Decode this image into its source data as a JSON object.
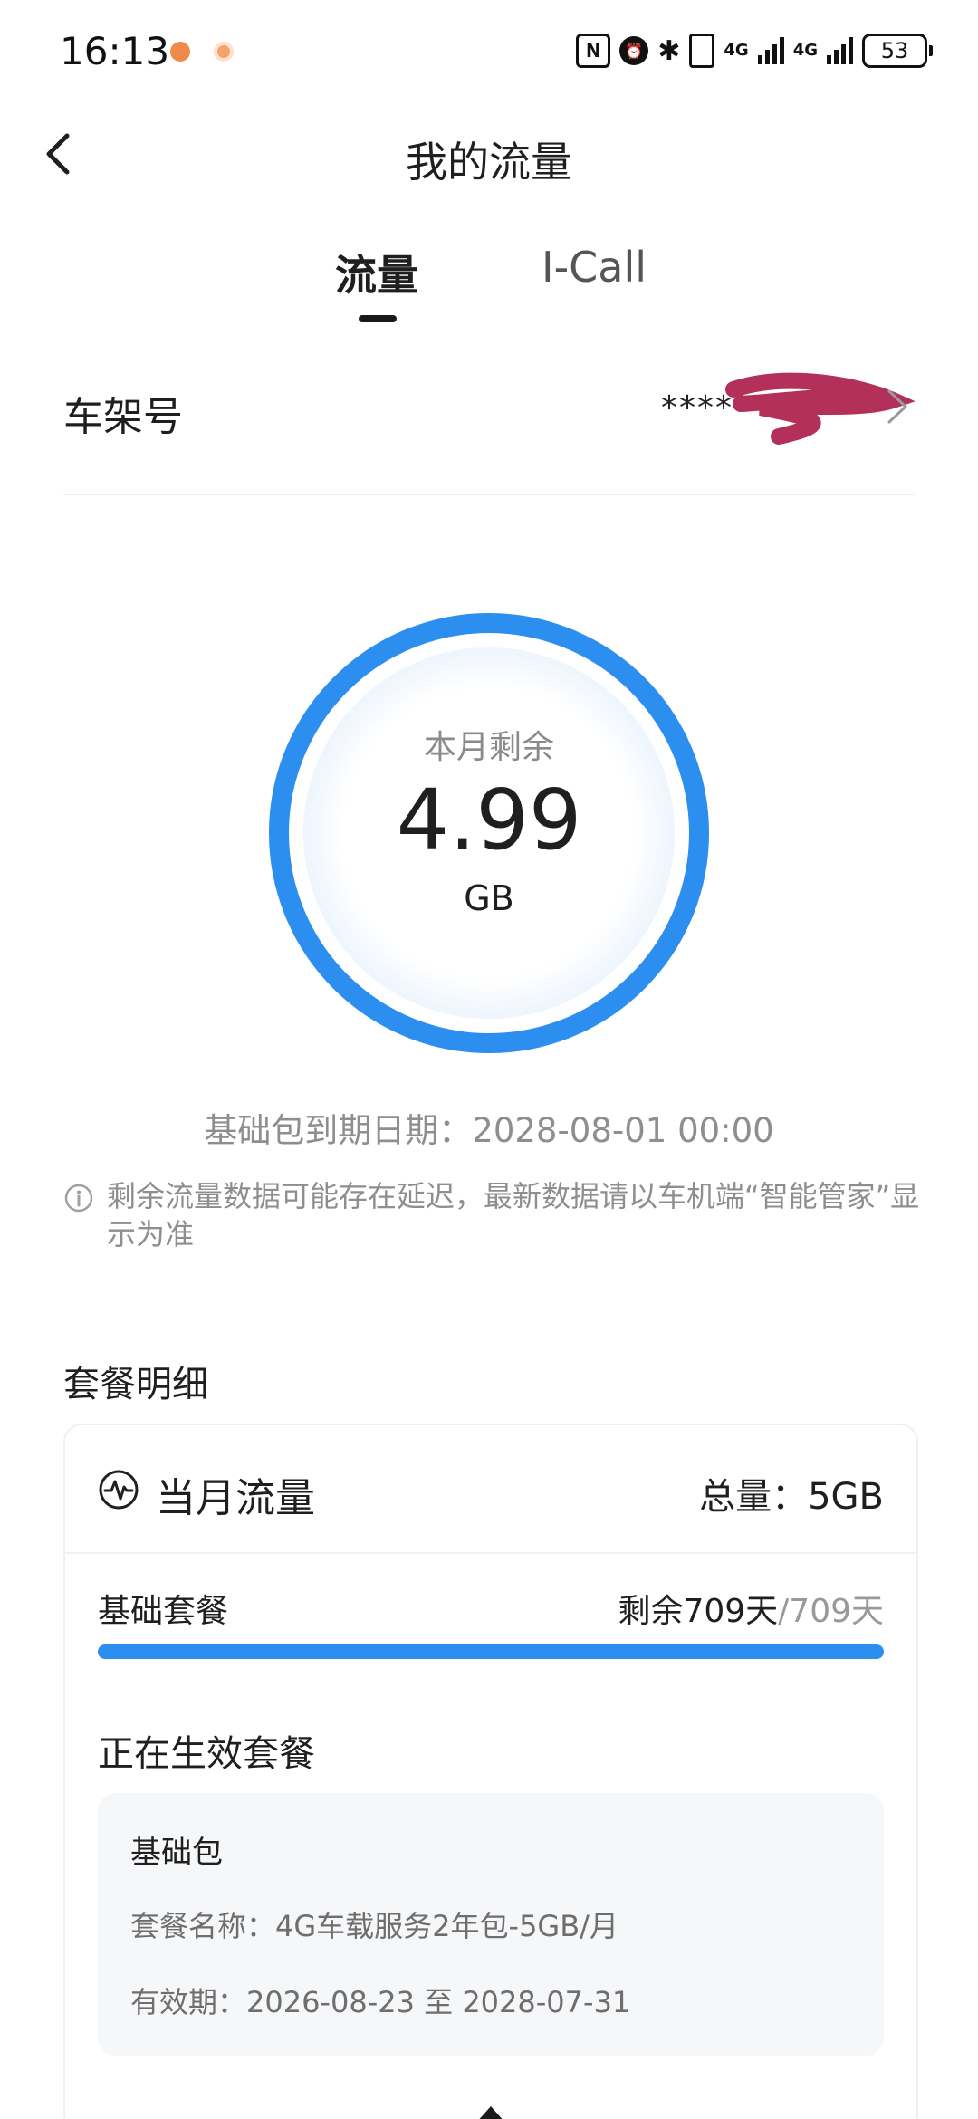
{
  "status_bar": {
    "time": "16:13",
    "network_1": "4G",
    "network_2": "4G",
    "battery": "53"
  },
  "header": {
    "title": "我的流量"
  },
  "tabs": [
    {
      "label": "流量",
      "active": true
    },
    {
      "label": "I-Call",
      "active": false
    }
  ],
  "vin": {
    "label": "车架号",
    "value": "***********"
  },
  "ring": {
    "label": "本月剩余",
    "value": "4.99",
    "unit": "GB",
    "color": "#2c8ff0",
    "fill_fraction": 1.0
  },
  "expire_text": "基础包到期日期：2028-08-01 00:00",
  "notice_text": "剩余流量数据可能存在延迟，最新数据请以车机端“智能管家”显示为准",
  "section_title": "套餐明细",
  "card": {
    "title": "当月流量",
    "total": "总量：5GB",
    "plan_name": "基础套餐",
    "remain_current": "剩余709天",
    "remain_total": "/709天",
    "progress_fraction": 1.0,
    "active_title": "正在生效套餐",
    "package": {
      "type": "基础包",
      "name_row": "套餐名称：4G车载服务2年包-5GB/月",
      "validity_row": "有效期：2026-08-23 至 2028-07-31"
    }
  },
  "colors": {
    "accent": "#2c8ff0",
    "text_primary": "#1f1f1f",
    "text_secondary": "#8e8e8e"
  },
  "icons": [
    "back-arrow-icon",
    "chevron-right-icon",
    "info-icon",
    "pulse-icon",
    "expand-arrow-icon"
  ]
}
